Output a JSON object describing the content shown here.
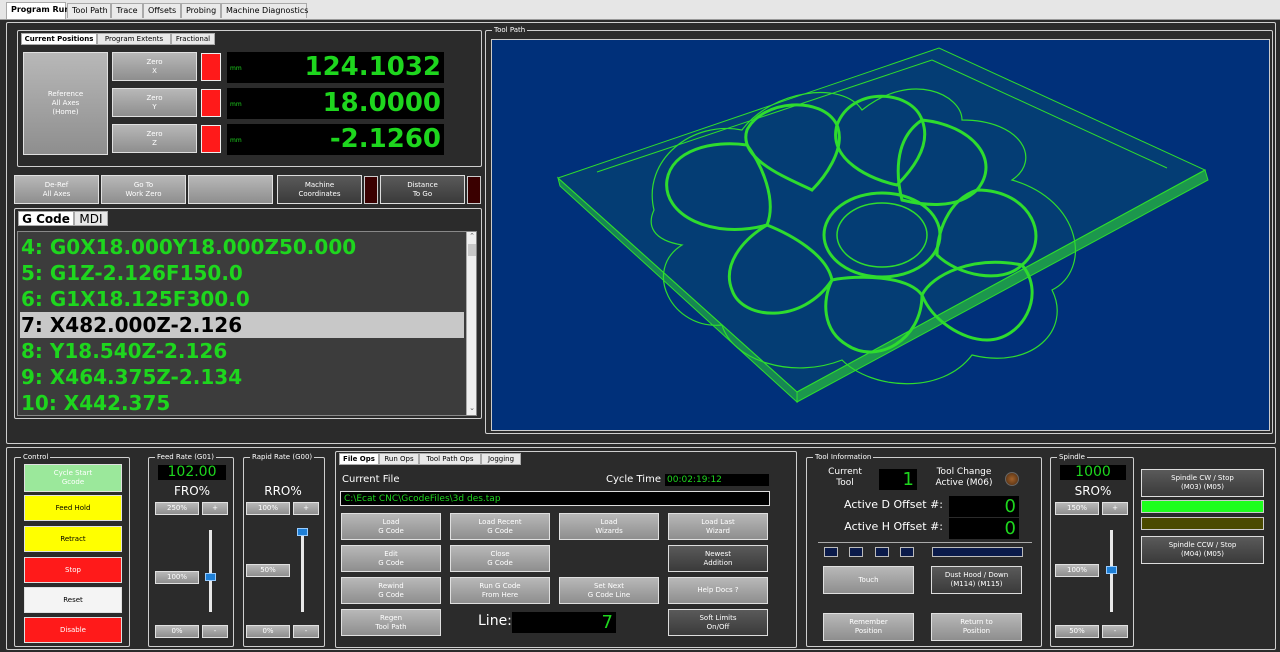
{
  "tabs": [
    "Program Run",
    "Tool Path",
    "Trace",
    "Offsets",
    "Probing",
    "Machine Diagnostics"
  ],
  "positions": {
    "tabs": [
      "Current Positions",
      "Program Extents",
      "Fractional"
    ],
    "reference_label": "Reference\nAll Axes\n(Home)",
    "axes": [
      {
        "zero_label": "Zero\nX",
        "unit": "mm",
        "value": "124.1032"
      },
      {
        "zero_label": "Zero\nY",
        "unit": "mm",
        "value": "18.0000"
      },
      {
        "zero_label": "Zero\nZ",
        "unit": "mm",
        "value": "-2.1260"
      }
    ],
    "deref_label": "De-Ref\nAll Axes",
    "goto_label": "Go To\nWork Zero",
    "machine_coords_label": "Machine\nCoordinates",
    "distance_label": "Distance\nTo Go"
  },
  "gcode": {
    "tabs": [
      "G Code",
      "MDI"
    ],
    "lines": [
      "4: G0X18.000Y18.000Z50.000",
      "5: G1Z-2.126F150.0",
      "6: G1X18.125F300.0",
      "7: X482.000Z-2.126",
      "8: Y18.540Z-2.126",
      "9: X464.375Z-2.134",
      "10: X442.375"
    ]
  },
  "toolpath": {
    "label": "Tool Path",
    "bg": "#00307a",
    "mesh": "#2edc2e"
  },
  "control": {
    "label": "Control",
    "cycle_start": "Cycle Start\nGcode",
    "feed_hold": "Feed Hold",
    "retract": "Retract",
    "stop": "Stop",
    "reset": "Reset",
    "disable": "Disable"
  },
  "feed": {
    "label": "Feed Rate (G01)",
    "value": "102.00",
    "percent_label": "FRO%",
    "btn_max": "250%",
    "btn_plus": "+",
    "btn_100": "100%",
    "btn_0": "0%",
    "btn_minus": "-",
    "slider": 0.41
  },
  "rapid": {
    "label": "Rapid Rate (G00)",
    "percent_label": "RRO%",
    "btn_100": "100%",
    "btn_plus": "+",
    "btn_50": "50%",
    "btn_0": "0%",
    "btn_minus": "-",
    "slider": 1.0
  },
  "fileops": {
    "tabs": [
      "File Ops",
      "Run Ops",
      "Tool Path Ops",
      "Jogging"
    ],
    "current_file_label": "Current File",
    "cycle_time_label": "Cycle Time",
    "cycle_time": "00:02:19:12",
    "file_path": "C:\\Ecat CNC\\GcodeFiles\\3d des.tap",
    "buttons": {
      "load_gcode": "Load\nG Code",
      "load_recent": "Load Recent\nG Code",
      "load_wizards": "Load\nWizards",
      "load_last_wizard": "Load Last\nWizard",
      "edit_gcode": "Edit\nG Code",
      "close_gcode": "Close\nG Code",
      "newest_addition": "Newest\nAddition",
      "rewind_gcode": "Rewind\nG Code",
      "run_from_here": "Run G Code\nFrom Here",
      "set_next_line": "Set Next\nG Code Line",
      "help_docs": "Help Docs  ?",
      "regen_toolpath": "Regen\nTool Path",
      "soft_limits": "Soft Limits\nOn/Off"
    },
    "line_label": "Line:",
    "line_value": "7"
  },
  "toolinfo": {
    "label": "Tool Information",
    "current_tool_label": "Current\nTool",
    "current_tool": "1",
    "tool_change_label": "Tool Change\nActive (M06)",
    "d_offset_label": "Active D Offset #:",
    "d_offset": "0",
    "h_offset_label": "Active H Offset #:",
    "h_offset": "0",
    "touch": "Touch",
    "dust_hood": "Dust Hood / Down\n(M114)  (M115)",
    "remember_position": "Remember\nPosition",
    "return_to_position": "Return to\nPosition"
  },
  "spindle": {
    "label": "Spindle",
    "value": "1000",
    "percent_label": "SRO%",
    "btn_150": "150%",
    "btn_plus": "+",
    "btn_100": "100%",
    "btn_50": "50%",
    "btn_minus": "-",
    "cw_label": "Spindle CW / Stop\n(M03)           (M05)",
    "ccw_label": "Spindle CCW / Stop\n(M04)           (M05)",
    "slider": 0.5
  }
}
